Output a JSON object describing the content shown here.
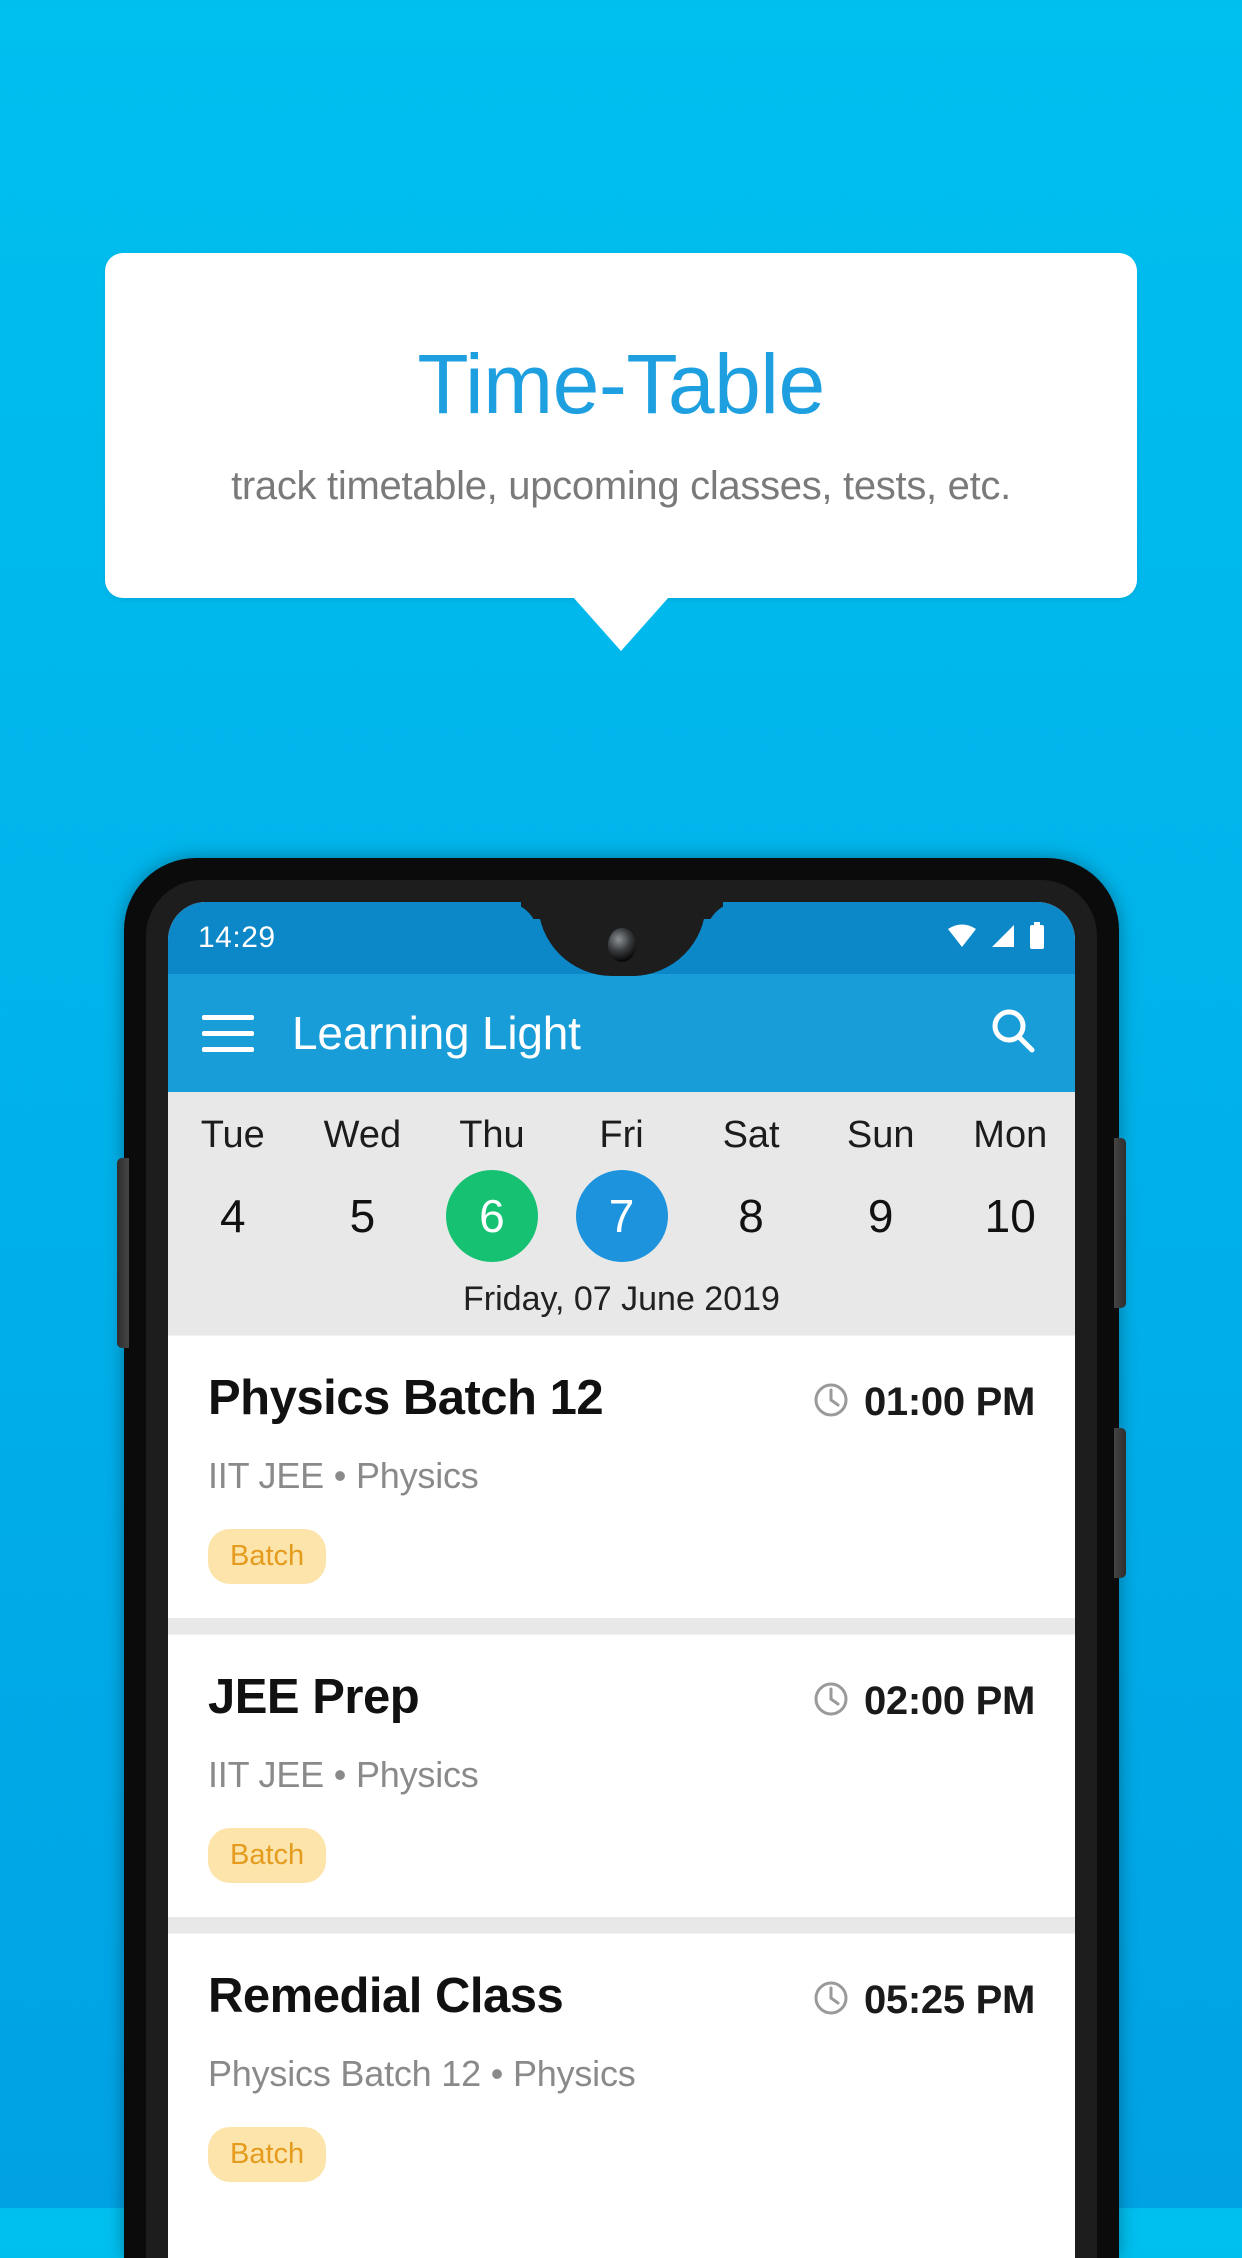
{
  "promo": {
    "title": "Time-Table",
    "subtitle": "track timetable, upcoming classes, tests, etc.",
    "title_color": "#1e9fe0",
    "background_color": "#ffffff"
  },
  "background": {
    "gradient_top": "#00c0f0",
    "gradient_bottom": "#00a2e4"
  },
  "phone": {
    "status_bar": {
      "time": "14:29",
      "icons": [
        "wifi-icon",
        "cellular-signal-icon",
        "battery-icon"
      ],
      "background_color": "#0c87c8"
    },
    "app_bar": {
      "menu_icon": "hamburger-menu-icon",
      "title": "Learning Light",
      "search_icon": "search-icon",
      "background_color": "#189dd9"
    },
    "date_strip": {
      "background_color": "#e8e8e8",
      "days": [
        {
          "weekday": "Tue",
          "date": "4",
          "state": "normal"
        },
        {
          "weekday": "Wed",
          "date": "5",
          "state": "normal"
        },
        {
          "weekday": "Thu",
          "date": "6",
          "state": "today"
        },
        {
          "weekday": "Fri",
          "date": "7",
          "state": "selected"
        },
        {
          "weekday": "Sat",
          "date": "8",
          "state": "normal"
        },
        {
          "weekday": "Sun",
          "date": "9",
          "state": "normal"
        },
        {
          "weekday": "Mon",
          "date": "10",
          "state": "normal"
        }
      ],
      "today_color": "#16c172",
      "selected_color": "#1e93dd",
      "full_date": "Friday, 07 June 2019"
    },
    "events": [
      {
        "title": "Physics Batch 12",
        "time": "01:00 PM",
        "subtitle": "IIT JEE • Physics",
        "chip": "Batch",
        "chip_bg": "#fce4ab",
        "chip_fg": "#e59b1e"
      },
      {
        "title": "JEE Prep",
        "time": "02:00 PM",
        "subtitle": "IIT JEE • Physics",
        "chip": "Batch",
        "chip_bg": "#fce4ab",
        "chip_fg": "#e59b1e"
      },
      {
        "title": "Remedial Class",
        "time": "05:25 PM",
        "subtitle": "Physics Batch 12 • Physics",
        "chip": "Batch",
        "chip_bg": "#fce4ab",
        "chip_fg": "#e59b1e"
      }
    ]
  }
}
